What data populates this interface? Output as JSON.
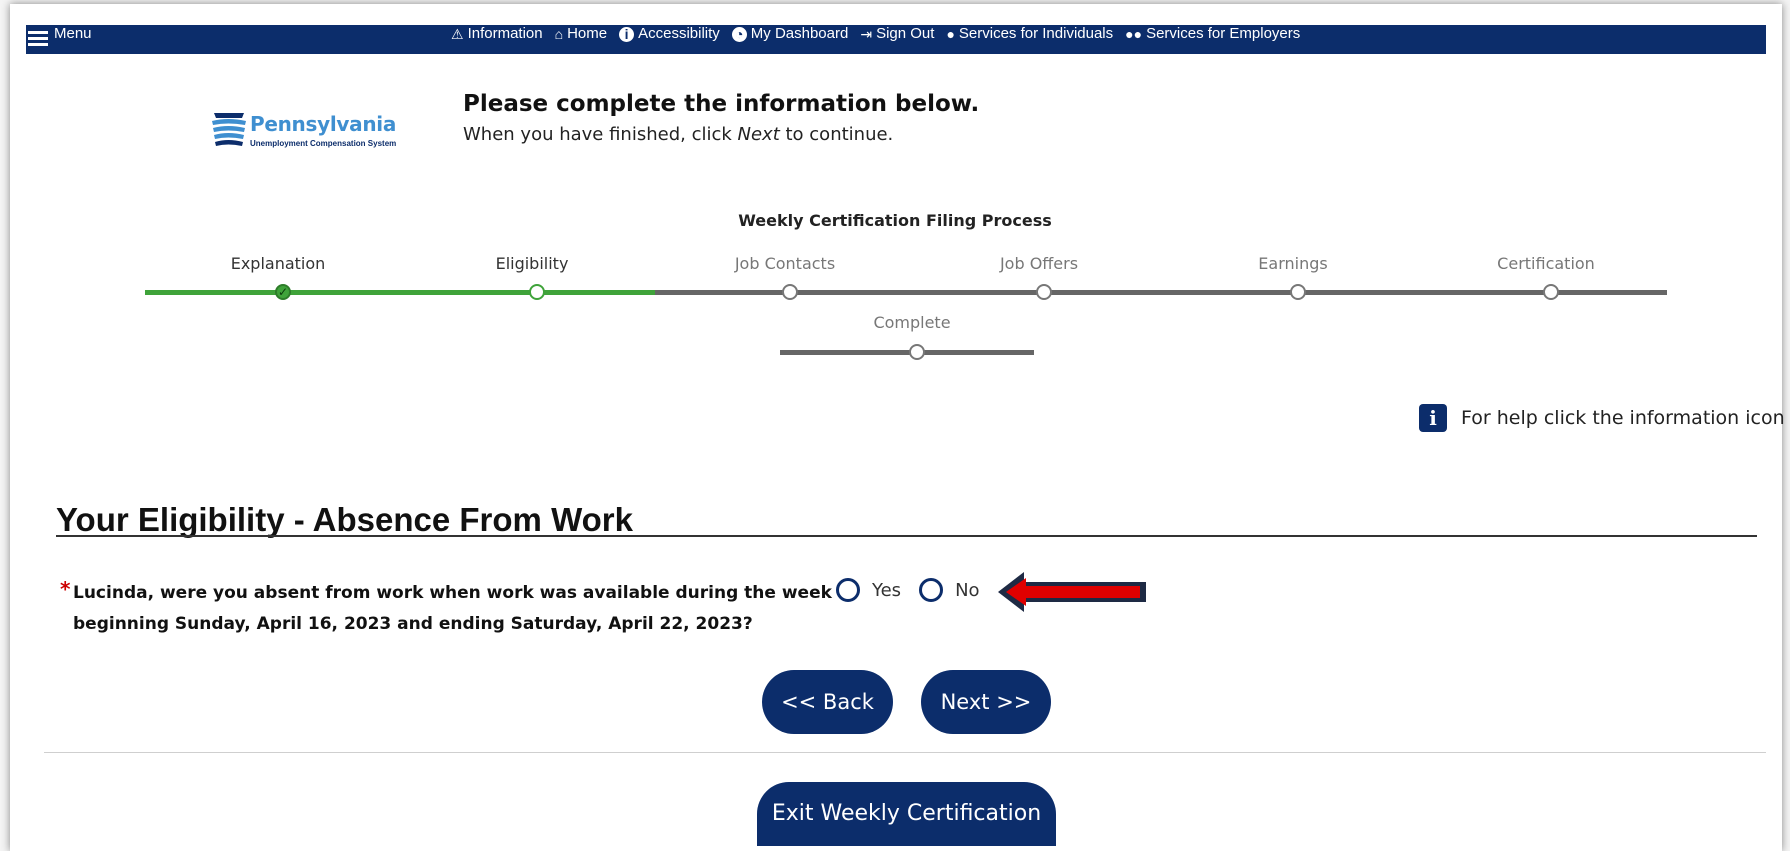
{
  "nav": {
    "menu_label": "Menu",
    "links": [
      {
        "label": "Information",
        "icon": "warning-icon"
      },
      {
        "label": "Home",
        "icon": "home-icon"
      },
      {
        "label": "Accessibility",
        "icon": "accessibility-icon"
      },
      {
        "label": "My Dashboard",
        "icon": "dashboard-icon"
      },
      {
        "label": "Sign Out",
        "icon": "sign-out-icon"
      },
      {
        "label": "Services for Individuals",
        "icon": "person-icon"
      },
      {
        "label": "Services for Employers",
        "icon": "group-icon"
      }
    ]
  },
  "logo": {
    "title": "Pennsylvania",
    "subtitle": "Unemployment Compensation System"
  },
  "header": {
    "title": "Please complete the information below.",
    "sub_prefix": "When you have finished, click ",
    "sub_emph": "Next",
    "sub_suffix": " to continue."
  },
  "process": {
    "title": "Weekly Certification Filing Process",
    "steps": [
      {
        "label": "Explanation",
        "state": "done"
      },
      {
        "label": "Eligibility",
        "state": "current"
      },
      {
        "label": "Job Contacts",
        "state": "pending"
      },
      {
        "label": "Job Offers",
        "state": "pending"
      },
      {
        "label": "Earnings",
        "state": "pending"
      },
      {
        "label": "Certification",
        "state": "pending"
      },
      {
        "label": "Complete",
        "state": "pending"
      }
    ]
  },
  "help": {
    "text": "For help click the information icon"
  },
  "section": {
    "title": "Your Eligibility - Absence From Work"
  },
  "question": {
    "required_mark": "*",
    "text": "Lucinda, were you absent from work when work was available during the week beginning Sunday, April 16, 2023 and ending Saturday, April 22, 2023?",
    "options": [
      "Yes",
      "No"
    ]
  },
  "buttons": {
    "back": "<< Back",
    "next": "Next >>",
    "exit": "Exit Weekly Certification"
  },
  "colors": {
    "navy": "#0c2d6b",
    "progress_done": "#3fa33a",
    "progress_pending": "#666666",
    "required": "#cc0000",
    "annotation_arrow": "#e00000"
  }
}
